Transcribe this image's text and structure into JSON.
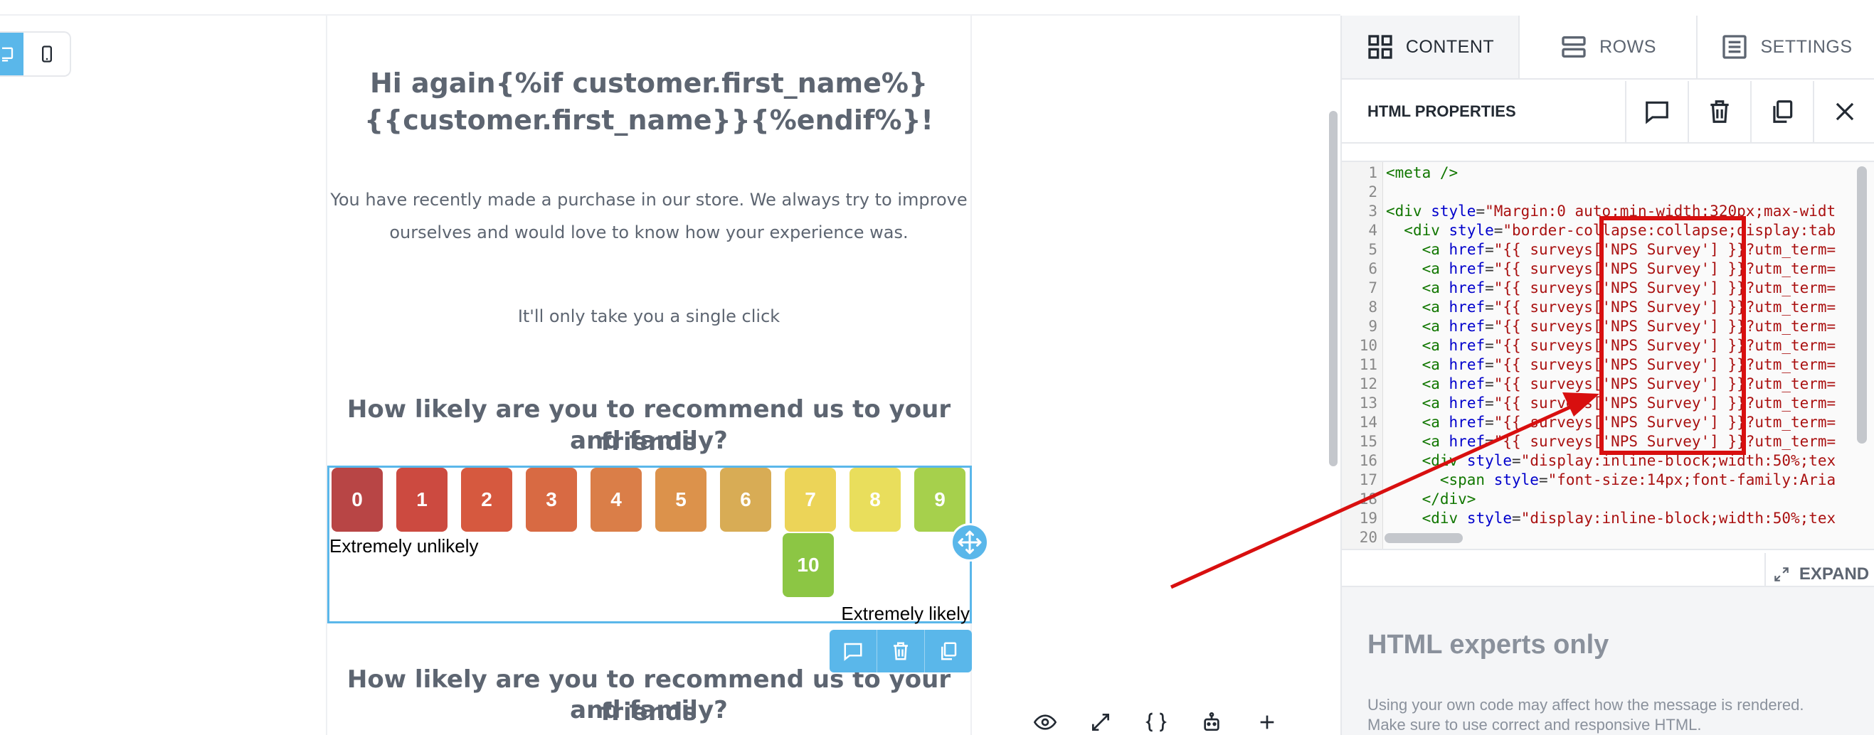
{
  "email": {
    "greeting_line1": "Hi again{%if customer.first_name%}",
    "greeting_line2": "{{customer.first_name}}{%endif%}!",
    "intro_line1": "You have recently made a purchase in our store. We always try to improve",
    "intro_line2": "ourselves and would love to know how your experience was.",
    "single_click": "It'll only take you a single click",
    "question_line1": "How likely are you to recommend us to your friends",
    "question_line2": "and family?",
    "question2_line1": "How likely are you to recommend us to your friends",
    "question2_line2": "and family?"
  },
  "nps": {
    "scores": [
      {
        "label": "0",
        "color": "#b84545"
      },
      {
        "label": "1",
        "color": "#cc4a40"
      },
      {
        "label": "2",
        "color": "#d6593f"
      },
      {
        "label": "3",
        "color": "#d86a43"
      },
      {
        "label": "4",
        "color": "#da7e48"
      },
      {
        "label": "5",
        "color": "#dc924b"
      },
      {
        "label": "6",
        "color": "#d8ac55"
      },
      {
        "label": "7",
        "color": "#ecd458"
      },
      {
        "label": "8",
        "color": "#e9de5c"
      },
      {
        "label": "9",
        "color": "#a6d04c"
      },
      {
        "label": "10",
        "color": "#8cc644"
      }
    ],
    "low_label": "Extremely unlikely",
    "high_label": "Extremely likely"
  },
  "panel": {
    "tabs": {
      "content": "CONTENT",
      "rows": "ROWS",
      "settings": "SETTINGS"
    },
    "properties_title": "HTML PROPERTIES",
    "expand_label": "EXPAND",
    "experts_title": "HTML experts only",
    "experts_desc_line1": "Using your own code may affect how the message is rendered.",
    "experts_desc_line2": "Make sure to use correct and responsive HTML.",
    "code_lines": [
      {
        "n": "1",
        "text": "<meta />"
      },
      {
        "n": "2",
        "text": ""
      },
      {
        "n": "3",
        "text": "<div style=\"Margin:0 auto;min-width:320px;max-widt"
      },
      {
        "n": "4",
        "text": "  <div style=\"border-collapse:collapse;display:tab"
      },
      {
        "n": "5",
        "text": "    <a href=\"{{ surveys['NPS Survey'] }}?utm_term="
      },
      {
        "n": "6",
        "text": "    <a href=\"{{ surveys['NPS Survey'] }}?utm_term="
      },
      {
        "n": "7",
        "text": "    <a href=\"{{ surveys['NPS Survey'] }}?utm_term="
      },
      {
        "n": "8",
        "text": "    <a href=\"{{ surveys['NPS Survey'] }}?utm_term="
      },
      {
        "n": "9",
        "text": "    <a href=\"{{ surveys['NPS Survey'] }}?utm_term="
      },
      {
        "n": "10",
        "text": "    <a href=\"{{ surveys['NPS Survey'] }}?utm_term="
      },
      {
        "n": "11",
        "text": "    <a href=\"{{ surveys['NPS Survey'] }}?utm_term="
      },
      {
        "n": "12",
        "text": "    <a href=\"{{ surveys['NPS Survey'] }}?utm_term="
      },
      {
        "n": "13",
        "text": "    <a href=\"{{ surveys['NPS Survey'] }}?utm_term="
      },
      {
        "n": "14",
        "text": "    <a href=\"{{ surveys['NPS Survey'] }}?utm_term="
      },
      {
        "n": "15",
        "text": "    <a href=\"{{ surveys['NPS Survey'] }}?utm_term="
      },
      {
        "n": "16",
        "text": "    <div style=\"display:inline-block;width:50%;tex"
      },
      {
        "n": "17",
        "text": "      <span style=\"font-size:14px;font-family:Aria"
      },
      {
        "n": "18",
        "text": "    </div>"
      },
      {
        "n": "19",
        "text": "    <div style=\"display:inline-block;width:50%;tex"
      },
      {
        "n": "20",
        "text": ""
      }
    ]
  },
  "colors": {
    "accent": "#5ab7ea",
    "annotation": "#d80f0f",
    "heading_text": "#5d6571"
  },
  "icons": {
    "desktop": "desktop-icon",
    "mobile": "mobile-icon",
    "move": "move-icon",
    "comment": "comment-icon",
    "trash": "trash-icon",
    "duplicate": "duplicate-icon",
    "close": "close-icon",
    "expand": "expand-icon",
    "preview": "eye-icon",
    "fullscreen": "fullscreen-icon",
    "merge_tags": "braces-icon",
    "ai": "robot-icon",
    "add": "plus-icon"
  }
}
